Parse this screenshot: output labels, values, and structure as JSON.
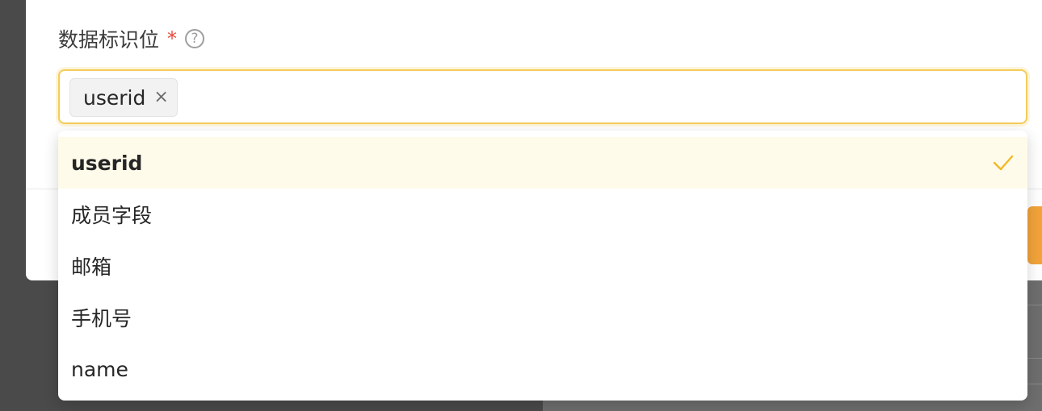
{
  "form": {
    "label": "数据标识位",
    "required_mark": "*",
    "help_icon": "?"
  },
  "select": {
    "selected_tags": [
      {
        "label": "userid",
        "close_glyph": "×"
      }
    ]
  },
  "dropdown": {
    "options": [
      {
        "label": "userid",
        "selected": true
      },
      {
        "label": "成员字段",
        "selected": false
      },
      {
        "label": "邮箱",
        "selected": false
      },
      {
        "label": "手机号",
        "selected": false
      },
      {
        "label": "name",
        "selected": false
      }
    ],
    "check_icon": "check-icon"
  },
  "colors": {
    "accent": "#f4cc5a",
    "selected_bg": "#fffbea",
    "check": "#f2b829",
    "required": "#e84a3a"
  }
}
